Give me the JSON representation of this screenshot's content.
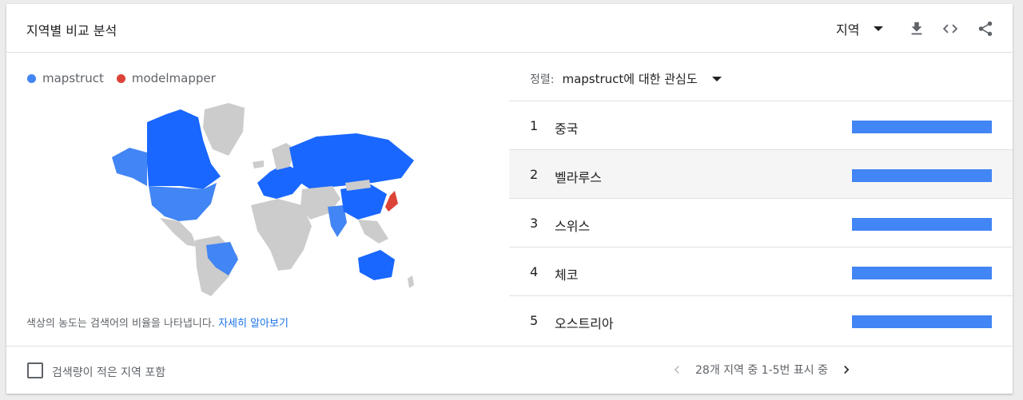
{
  "header": {
    "title": "지역별 비교 분석",
    "region_select": "지역",
    "icons": [
      "download-icon",
      "embed-code-icon",
      "share-icon"
    ]
  },
  "legend": [
    {
      "label": "mapstruct",
      "color": "#4285f4"
    },
    {
      "label": "modelmapper",
      "color": "#db4437"
    }
  ],
  "map_note": {
    "text": "색상의 농도는 검색어의 비율을 나타냅니다. ",
    "link": "자세히 알아보기"
  },
  "sort": {
    "label": "정렬:",
    "value": "mapstruct에 대한 관심도"
  },
  "rows": [
    {
      "rank": "1",
      "name": "중국",
      "share": 1.0
    },
    {
      "rank": "2",
      "name": "벨라루스",
      "share": 1.0
    },
    {
      "rank": "3",
      "name": "스위스",
      "share": 1.0
    },
    {
      "rank": "4",
      "name": "체코",
      "share": 1.0
    },
    {
      "rank": "5",
      "name": "오스트리아",
      "share": 1.0
    }
  ],
  "footer": {
    "checkbox_label": "검색량이 적은 지역 포함",
    "pagination": "28개 지역 중 1-5번 표시 중"
  },
  "colors": {
    "bar": "#4285f4",
    "accent_link": "#1a73e8"
  }
}
